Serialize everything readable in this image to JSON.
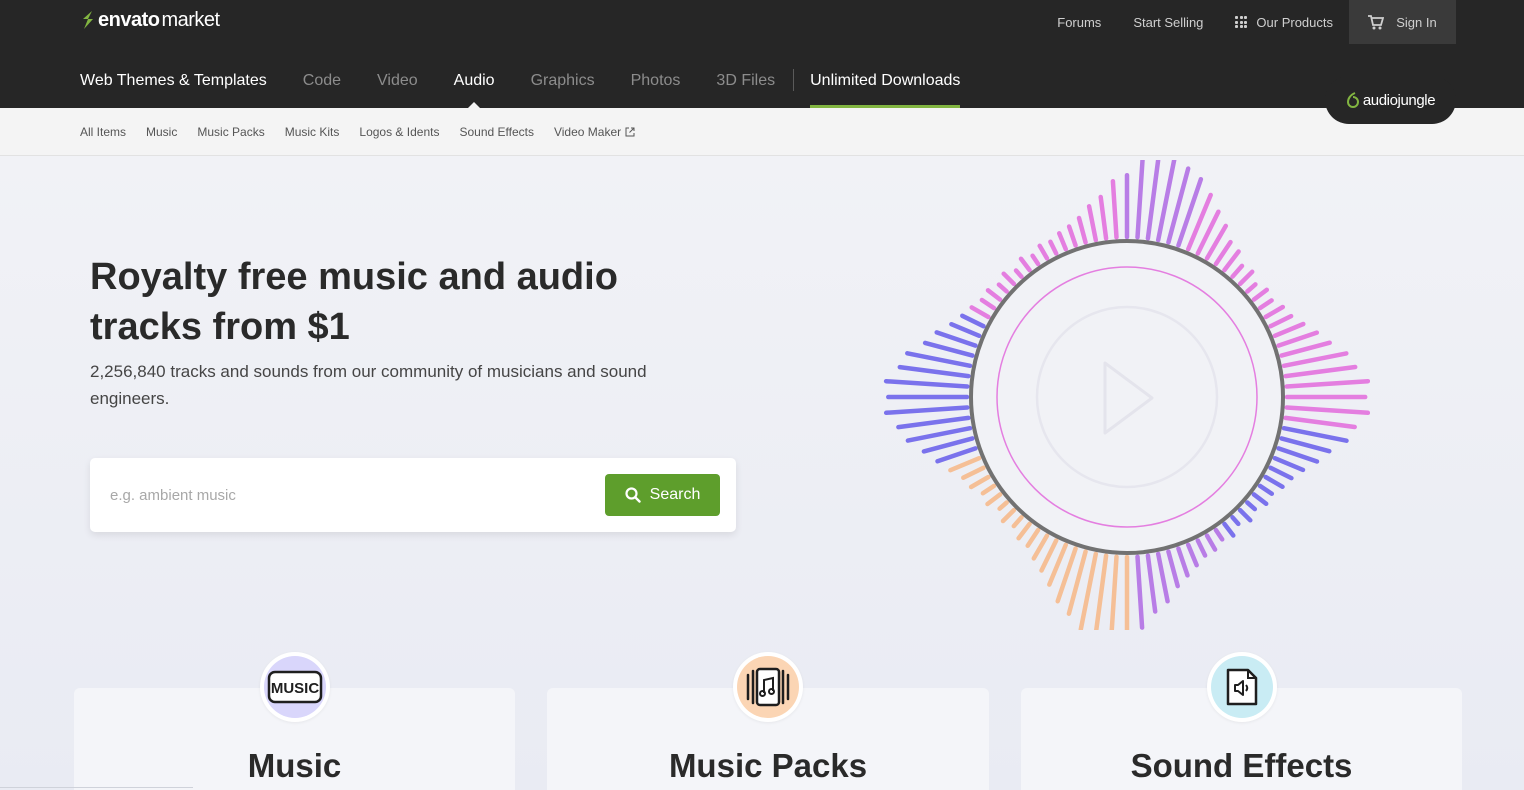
{
  "header": {
    "logo_brand": "envato",
    "logo_sub": "market",
    "links": [
      "Forums",
      "Start Selling",
      "Our Products"
    ],
    "signin": "Sign In"
  },
  "nav": {
    "items": [
      "Web Themes & Templates",
      "Code",
      "Video",
      "Audio",
      "Graphics",
      "Photos",
      "3D Files"
    ],
    "unlimited": "Unlimited Downloads",
    "active": "Audio"
  },
  "badge": {
    "label": "audiojungle"
  },
  "subnav": {
    "items": [
      "All Items",
      "Music",
      "Music Packs",
      "Music Kits",
      "Logos & Idents",
      "Sound Effects",
      "Video Maker"
    ]
  },
  "hero": {
    "title": "Royalty free music and audio tracks from $1",
    "subtitle": "2,256,840 tracks and sounds from our community of musicians and sound engineers.",
    "search_placeholder": "e.g. ambient music",
    "search_button": "Search"
  },
  "cards": [
    {
      "title": "Music",
      "icon_text": "MUSIC",
      "icon": "music-label-icon",
      "icon_color": "#d9d6fb"
    },
    {
      "title": "Music Packs",
      "icon": "music-pack-icon",
      "icon_color": "#fbd5b4"
    },
    {
      "title": "Sound Effects",
      "icon": "sound-file-icon",
      "icon_color": "#c9ecf4"
    }
  ],
  "colors": {
    "header_bg": "#262626",
    "accent_green": "#5e9e2c",
    "unlimited_underline": "#82b541",
    "wave_blue": "#7a72ec",
    "wave_pink": "#e47ee0",
    "wave_purple": "#b87de6",
    "wave_peach": "#f5bf96"
  }
}
